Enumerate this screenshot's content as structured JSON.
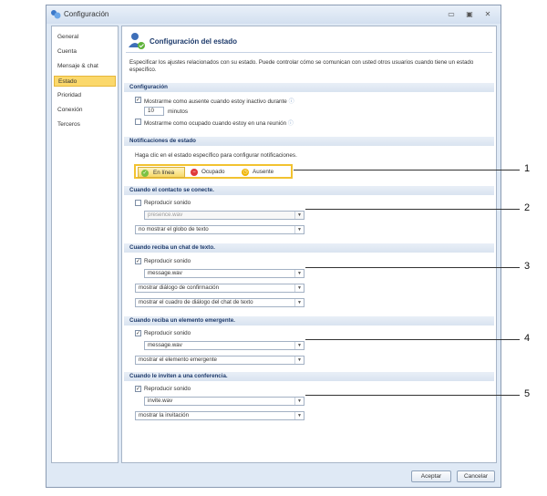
{
  "window": {
    "title": "Configuración",
    "minimize": "▭",
    "maximize": "▣",
    "close": "✕"
  },
  "sidebar": {
    "items": [
      {
        "label": "General"
      },
      {
        "label": "Cuenta"
      },
      {
        "label": "Mensaje & chat"
      },
      {
        "label": "Estado"
      },
      {
        "label": "Prioridad"
      },
      {
        "label": "Conexión"
      },
      {
        "label": "Terceros"
      }
    ],
    "selected": "Estado"
  },
  "main": {
    "title": "Configuración del estado",
    "description": "Especificar los ajustes relacionados con su estado. Puede controlar cómo se comunican con usted otros usuarios cuando tiene un estado específico.",
    "config_section": {
      "header": "Configuración",
      "away_label": "Mostrarme como ausente cuando estoy inactivo durante",
      "away_checked": true,
      "minutes_value": "10",
      "minutes_label": "minutos",
      "busy_label": "Mostrarme como ocupado cuando estoy en una reunión",
      "busy_checked": false
    },
    "notif_section": {
      "header": "Notificaciones de estado",
      "hint": "Haga clic en el estado específico para configurar notificaciones.",
      "tabs": [
        {
          "label": "En línea",
          "color": "#7cc243"
        },
        {
          "label": "Ocupado",
          "color": "#e03a3a"
        },
        {
          "label": "Ausente",
          "color": "#f0b400"
        }
      ],
      "selected_tab": "En línea"
    },
    "groups": [
      {
        "header": "Cuando el contacto se conecte.",
        "sound_label": "Reproducir sonido",
        "sound_checked": false,
        "sound_file": "presence.wav",
        "action": "no mostrar el globo de texto"
      },
      {
        "header": "Cuando reciba un chat de texto.",
        "sound_label": "Reproducir sonido",
        "sound_checked": true,
        "sound_file": "message.wav",
        "action": "mostrar diálogo de confirmación",
        "action2": "mostrar el cuadro de diálogo del chat de texto"
      },
      {
        "header": "Cuando reciba un elemento emergente.",
        "sound_label": "Reproducir sonido",
        "sound_checked": true,
        "sound_file": "message.wav",
        "action": "mostrar el elemento emergente"
      },
      {
        "header": "Cuando le inviten a una conferencia.",
        "sound_label": "Reproducir sonido",
        "sound_checked": true,
        "sound_file": "invite.wav",
        "action": "mostrar la invitación"
      }
    ]
  },
  "buttons": {
    "accept": "Aceptar",
    "cancel": "Cancelar"
  },
  "callouts": [
    "1",
    "2",
    "3",
    "4",
    "5"
  ],
  "icons": {
    "check": "✓",
    "dropdown": "▼",
    "info": "ⓘ"
  }
}
